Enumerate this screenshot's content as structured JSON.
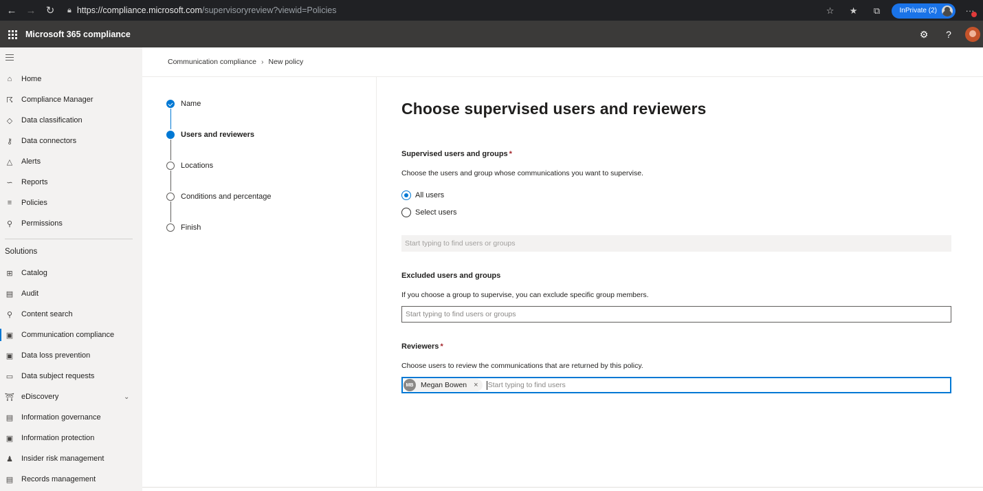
{
  "browser": {
    "url_host": "https://compliance.microsoft.com",
    "url_path": "/supervisoryreview?viewid=Policies",
    "inprivate_label": "InPrivate (2)"
  },
  "app": {
    "title": "Microsoft 365 compliance"
  },
  "nav": {
    "items": [
      {
        "label": "Home",
        "icon": "home-icon"
      },
      {
        "label": "Compliance Manager",
        "icon": "trophy-icon"
      },
      {
        "label": "Data classification",
        "icon": "tag-icon"
      },
      {
        "label": "Data connectors",
        "icon": "connector-icon"
      },
      {
        "label": "Alerts",
        "icon": "alert-icon"
      },
      {
        "label": "Reports",
        "icon": "chart-icon"
      },
      {
        "label": "Policies",
        "icon": "sliders-icon"
      },
      {
        "label": "Permissions",
        "icon": "key-icon"
      }
    ],
    "solutions_label": "Solutions",
    "solutions": [
      {
        "label": "Catalog",
        "icon": "catalog-icon"
      },
      {
        "label": "Audit",
        "icon": "audit-icon"
      },
      {
        "label": "Content search",
        "icon": "search-icon"
      },
      {
        "label": "Communication compliance",
        "icon": "chat-icon"
      },
      {
        "label": "Data loss prevention",
        "icon": "shield-doc-icon"
      },
      {
        "label": "Data subject requests",
        "icon": "document-icon"
      },
      {
        "label": "eDiscovery",
        "icon": "building-icon"
      },
      {
        "label": "Information governance",
        "icon": "archive-icon"
      },
      {
        "label": "Information protection",
        "icon": "lock-doc-icon"
      },
      {
        "label": "Insider risk management",
        "icon": "person-icon"
      },
      {
        "label": "Records management",
        "icon": "records-icon"
      }
    ]
  },
  "breadcrumb": {
    "root": "Communication compliance",
    "current": "New policy"
  },
  "steps": [
    {
      "label": "Name",
      "state": "done"
    },
    {
      "label": "Users and reviewers",
      "state": "current"
    },
    {
      "label": "Locations",
      "state": "todo"
    },
    {
      "label": "Conditions and percentage",
      "state": "todo"
    },
    {
      "label": "Finish",
      "state": "todo"
    }
  ],
  "form": {
    "title": "Choose supervised users and reviewers",
    "supervised": {
      "label": "Supervised users and groups",
      "required_mark": "*",
      "description": "Choose the users and group whose communications you want to supervise.",
      "options": [
        "All users",
        "Select users"
      ],
      "selected": "All users",
      "placeholder": "Start typing to find users or groups"
    },
    "excluded": {
      "label": "Excluded users and groups",
      "description": "If you choose a group to supervise, you can exclude specific group members.",
      "placeholder": "Start typing to find users or groups"
    },
    "reviewers": {
      "label": "Reviewers",
      "required_mark": "*",
      "description": "Choose users to review the communications that are returned by this policy.",
      "selected_initials": "MB",
      "selected_name": "Megan Bowen",
      "placeholder": "Start typing to find users"
    }
  }
}
